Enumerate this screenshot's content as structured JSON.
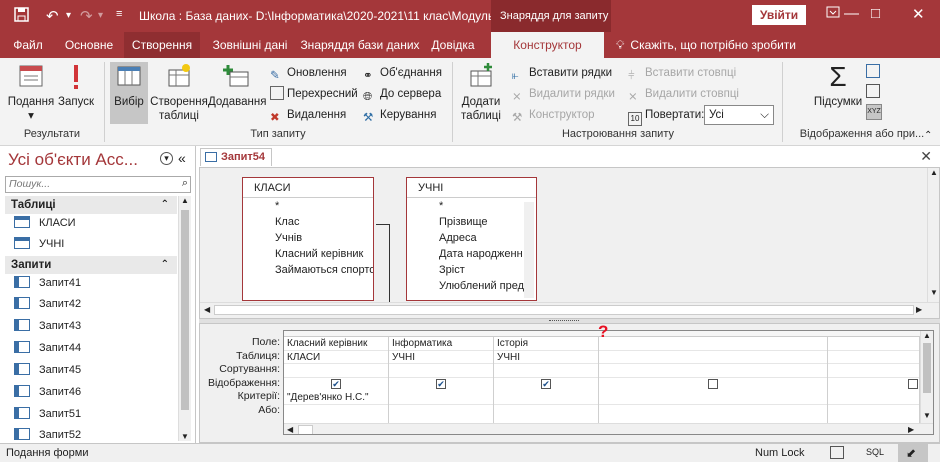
{
  "titlebar": {
    "title": "Школа : База даних- D:\\Інформатика\\2020-2021\\11 клас\\Модуль...",
    "context_group": "Знаряддя для запиту",
    "signin": "Увійти",
    "quick_access": [
      "save-icon",
      "undo-icon",
      "redo-icon",
      "customize-icon"
    ],
    "colors": {
      "brand": "#a4373a",
      "context": "#8a2a2d"
    }
  },
  "tabs": [
    {
      "label": "Файл"
    },
    {
      "label": "Основне"
    },
    {
      "label": "Створення"
    },
    {
      "label": "Зовнішні дані"
    },
    {
      "label": "Знаряддя бази даних"
    },
    {
      "label": "Довідка"
    },
    {
      "label": "Конструктор"
    }
  ],
  "tellme": "Скажіть, що потрібно зробити",
  "ribbon": {
    "results": {
      "label": "Результати",
      "view": "Подання",
      "run": "Запуск"
    },
    "querytype": {
      "label": "Тип запиту",
      "select": "Вибір",
      "maketable": [
        "Створення",
        "таблиці"
      ],
      "append": "Додавання",
      "update": "Оновлення",
      "crosstab": "Перехресний",
      "delete": "Видалення",
      "union": "Об'єднання",
      "passthrough": "До сервера",
      "datadef": "Керування"
    },
    "setup": {
      "label": "Настроювання запиту",
      "showtable": [
        "Додати",
        "таблиці"
      ],
      "insertrows": "Вставити рядки",
      "deleterows": "Видалити рядки",
      "builder": "Конструктор",
      "insertcols": "Вставити стовпці",
      "deletecols": "Видалити стовпці",
      "returnlabel": "Повертати:",
      "returnvalue": "Усі"
    },
    "showhide": {
      "label": "Відображення або при...",
      "totals": "Підсумки"
    }
  },
  "nav": {
    "title": "Усі об'єкти Acc...",
    "search_placeholder": "Пошук...",
    "sections": [
      {
        "label": "Таблиці",
        "items": [
          "КЛАСИ",
          "УЧНІ"
        ]
      },
      {
        "label": "Запити",
        "items": [
          "Запит41",
          "Запит42",
          "Запит43",
          "Запит44",
          "Запит45",
          "Запит46",
          "Запит51",
          "Запит52"
        ]
      }
    ]
  },
  "doc": {
    "tab": "Запит54",
    "tables": [
      {
        "name": "КЛАСИ",
        "fields": [
          "*",
          "Клас",
          "Учнів",
          "Класний керівник",
          "Займаються спорто"
        ]
      },
      {
        "name": "УЧНІ",
        "fields": [
          "*",
          "Прізвище",
          "Адреса",
          "Дата народженн",
          "Зріст",
          "Улюблений пред"
        ]
      }
    ],
    "row_labels": [
      "Поле:",
      "Таблиця:",
      "Сортування:",
      "Відображення:",
      "Критерії:",
      "Або:"
    ],
    "columns": [
      {
        "field": "Класний керівник",
        "table": "КЛАСИ",
        "sort": "",
        "show": true,
        "criteria": "\"Дерев'янко Н.С.\""
      },
      {
        "field": "Інформатика",
        "table": "УЧНІ",
        "sort": "",
        "show": true,
        "criteria": ""
      },
      {
        "field": "Історія",
        "table": "УЧНІ",
        "sort": "",
        "show": true,
        "criteria": ""
      },
      {
        "field": "",
        "table": "",
        "sort": "",
        "show": false,
        "criteria": ""
      },
      {
        "field": "",
        "table": "",
        "sort": "",
        "show": false,
        "criteria": ""
      }
    ],
    "marker": "?"
  },
  "status": {
    "left": "Подання форми",
    "numlock": "Num Lock",
    "sql": "SQL"
  }
}
